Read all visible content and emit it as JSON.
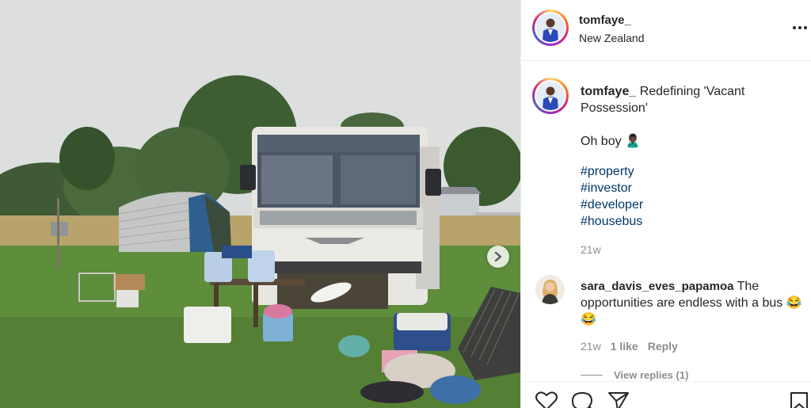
{
  "post": {
    "username": "tomfaye_",
    "location": "New Zealand",
    "more_label": "...",
    "caption": {
      "username": "tomfaye_",
      "text": "Redefining 'Vacant Possession'",
      "line2": "Oh boy 🙎🏿‍♂️",
      "hashtags": [
        "#property",
        "#investor",
        "#developer",
        "#housebus"
      ],
      "time": "21w"
    }
  },
  "comment": {
    "username": "sara_davis_eves_papamoa",
    "text": "The opportunities are endless with a bus 😂 😂",
    "time": "21w",
    "likes": "1 like",
    "reply_label": "Reply",
    "view_replies": "View replies (1)"
  },
  "colors": {
    "hashtag": "#00376b",
    "meta_gray": "#8e8e8e",
    "text": "#262626"
  },
  "icons": [
    "heart-icon",
    "comment-icon",
    "share-icon",
    "bookmark-icon",
    "chevron-right-icon",
    "more-icon"
  ]
}
